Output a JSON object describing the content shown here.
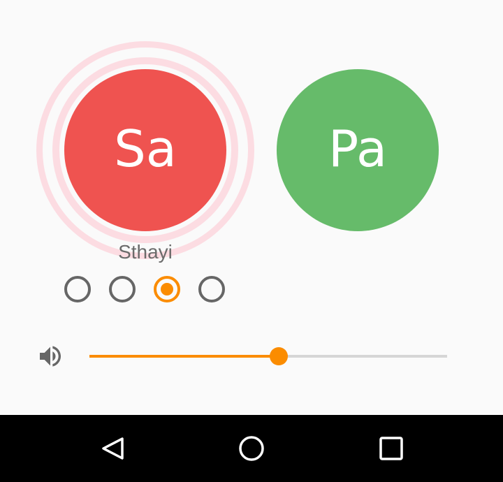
{
  "colors": {
    "sa": "#ef5350",
    "pa": "#66bb6a",
    "accent": "#fb8c00",
    "ring": "#fcdce2"
  },
  "notes": [
    {
      "label": "Sa",
      "color": "#ef5350",
      "playing": true
    },
    {
      "label": "Pa",
      "color": "#66bb6a",
      "playing": false
    }
  ],
  "octave": {
    "label": "Sthayi",
    "options_count": 4,
    "selected_index": 2
  },
  "volume": {
    "icon": "volume-up-icon",
    "level": 0.53
  },
  "navigation": {
    "icons": [
      "back-triangle-icon",
      "home-circle-icon",
      "recents-square-icon"
    ]
  }
}
